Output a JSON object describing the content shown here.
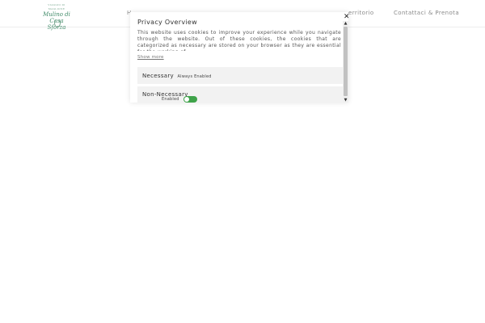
{
  "header": {
    "logo": {
      "top_text": "VIAGGIO DI MAGLIONE",
      "line1": "Mulino di",
      "line2": "Casa Sforza"
    },
    "nav": {
      "home": "H",
      "territorio": "erritorio",
      "contatti": "Contattaci & Prenota"
    }
  },
  "cookie_dialog": {
    "close_icon": "close-icon",
    "close_glyph": "✕",
    "title": "Privacy Overview",
    "text": "This website uses cookies to improve your experience while you navigate through the website. Out of these cookies, the cookies that are categorized as necessary are stored on your browser as they are essential for the working of",
    "show_more": "Show more",
    "categories": [
      {
        "name": "Necessary",
        "status": "Always Enabled"
      },
      {
        "name": "Non-Necessary",
        "status": "Enabled",
        "toggle_on": true
      }
    ],
    "scrollbar": {
      "up_glyph": "▲",
      "down_glyph": "▼"
    }
  },
  "colors": {
    "brand_green": "#3f8a68",
    "toggle_on": "#3fa34a",
    "category_bg": "#f2f2f2"
  }
}
